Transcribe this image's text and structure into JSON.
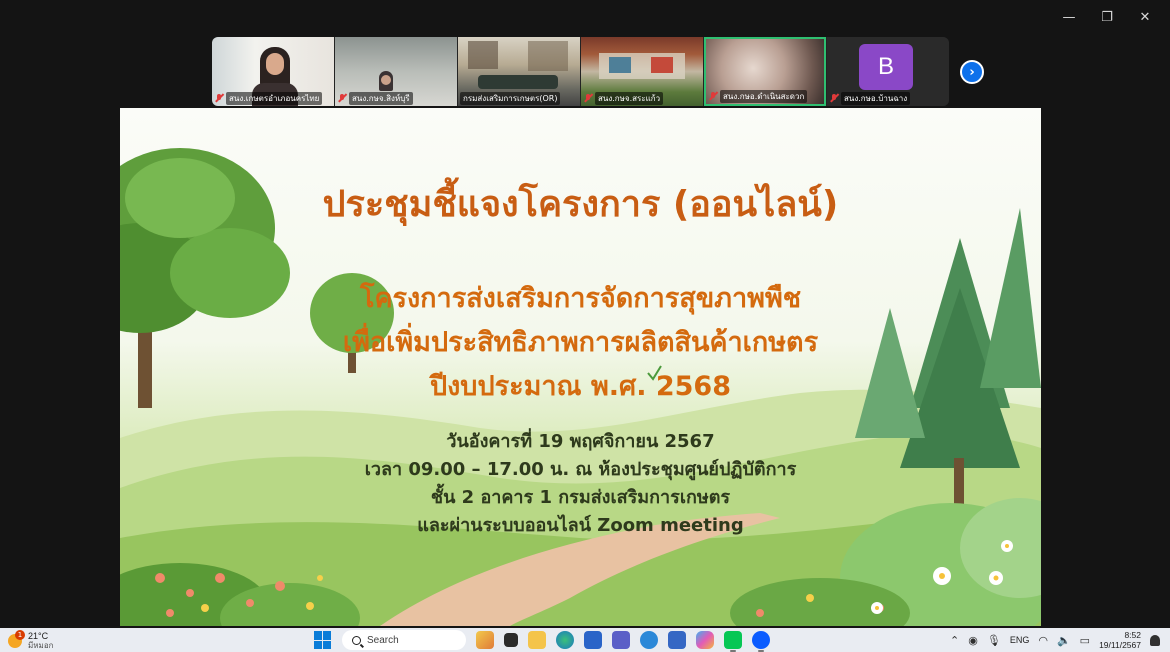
{
  "window": {
    "minimize_glyph": "—",
    "restore_glyph": "❐",
    "close_glyph": "✕"
  },
  "participants": [
    {
      "name": "สนง.เกษตรอำเภอนครไทย",
      "muted": true
    },
    {
      "name": "สนง.กษจ.สิงห์บุรี",
      "muted": true
    },
    {
      "name": "กรมส่งเสริมการเกษตร(OR)",
      "muted": false
    },
    {
      "name": "สนง.กษจ.สระแก้ว",
      "muted": true
    },
    {
      "name": "สนง.กษอ.ดำเนินสะดวก",
      "muted": true,
      "active": true
    },
    {
      "name": "สนง.กษอ.บ้านฉาง",
      "muted": true,
      "avatar_letter": "B"
    }
  ],
  "slide": {
    "title": "ประชุมชี้แจงโครงการ (ออนไลน์)",
    "subtitle_lines": [
      "โครงการส่งเสริมการจัดการสุขภาพพืช",
      "เพื่อเพิ่มประสิทธิภาพการผลิตสินค้าเกษตร",
      "ปีงบประมาณ พ.ศ. 2568"
    ],
    "info_lines": [
      "วันอังคารที่ 19 พฤศจิกายน 2567",
      "เวลา 09.00 – 17.00 น. ณ ห้องประชุมศูนย์ปฏิบัติการ",
      "ชั้น 2 อาคาร 1 กรมส่งเสริมการเกษตร",
      "และผ่านระบบออนไลน์ Zoom meeting"
    ]
  },
  "taskbar": {
    "weather_temp": "21°C",
    "weather_desc": "มีหมอก",
    "weather_badge": "1",
    "search_placeholder": "Search",
    "language": "ENG",
    "time": "8:52",
    "date": "19/11/2567"
  },
  "colors": {
    "title": "#c85d13",
    "subtitle": "#d46a0e",
    "info": "#2e3a1c",
    "active_border": "#2fbf71",
    "next_button": "#0e71eb"
  }
}
